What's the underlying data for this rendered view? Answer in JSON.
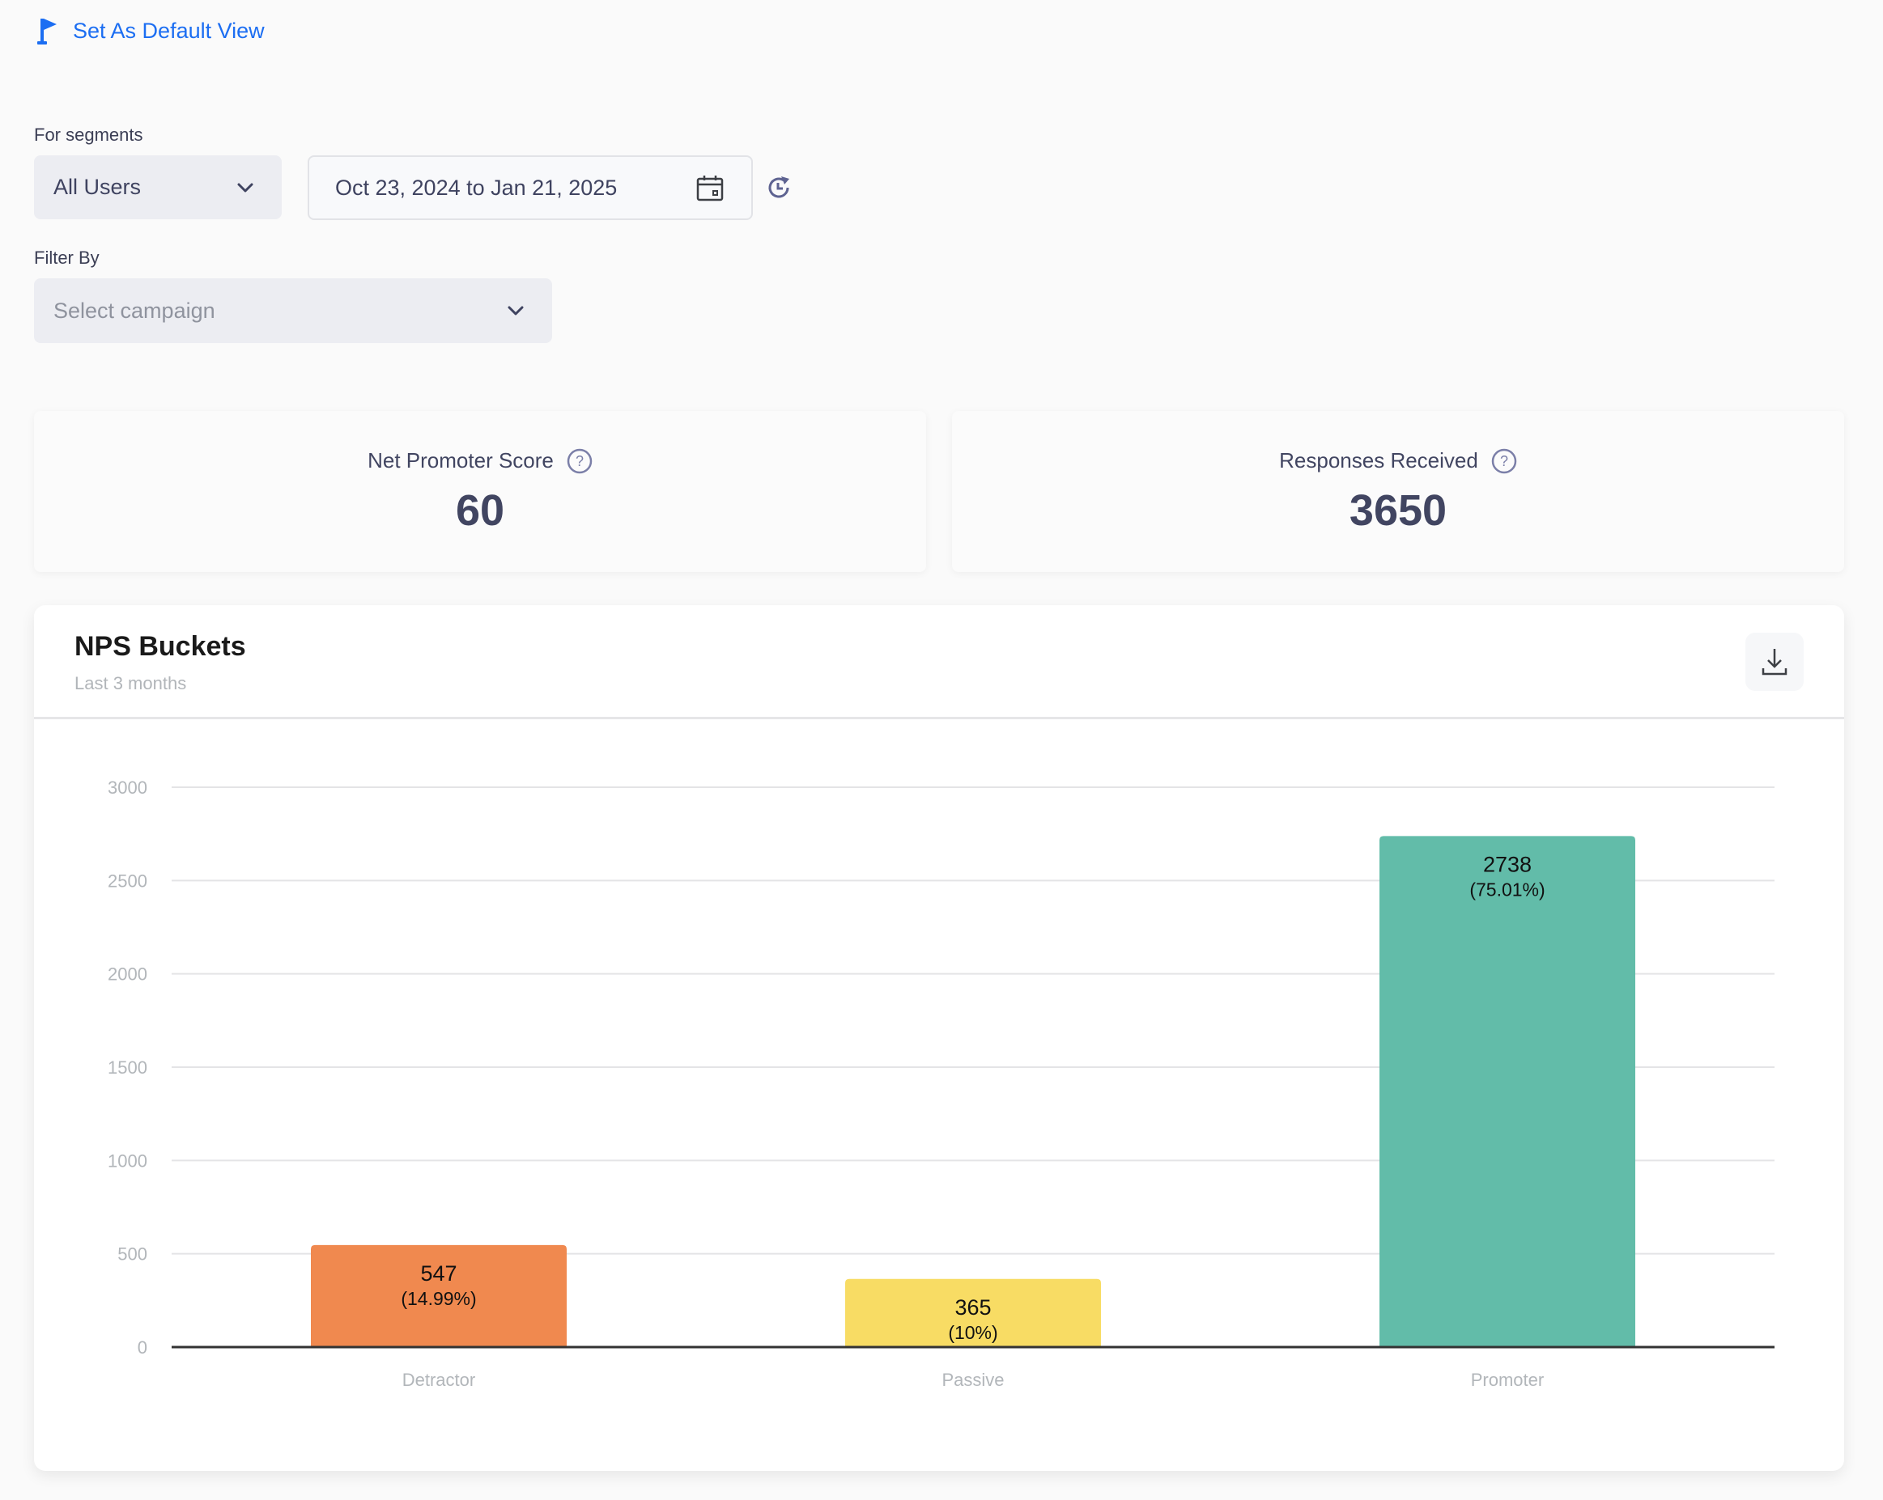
{
  "header": {
    "default_view_label": "Set As Default View"
  },
  "filters": {
    "segments_label": "For segments",
    "segment_value": "All Users",
    "date_range": "Oct 23, 2024 to Jan 21, 2025",
    "filter_by_label": "Filter By",
    "campaign_placeholder": "Select campaign"
  },
  "stats": [
    {
      "label": "Net Promoter Score",
      "value": "60"
    },
    {
      "label": "Responses Received",
      "value": "3650"
    }
  ],
  "colors": {
    "link": "#1c6ef2",
    "detractor": "#f0894f",
    "passive": "#f8dc64",
    "promoter": "#62bca9"
  },
  "chart_data": {
    "type": "bar",
    "title": "NPS Buckets",
    "subtitle": "Last 3 months",
    "categories": [
      "Detractor",
      "Passive",
      "Promoter"
    ],
    "values": [
      547,
      365,
      2738
    ],
    "percent_labels": [
      "(14.99%)",
      "(10%)",
      "(75.01%)"
    ],
    "xlabel": "",
    "ylabel": "",
    "ylim": [
      0,
      3000
    ],
    "yticks": [
      0,
      500,
      1000,
      1500,
      2000,
      2500,
      3000
    ],
    "grid": true,
    "legend": "none"
  }
}
